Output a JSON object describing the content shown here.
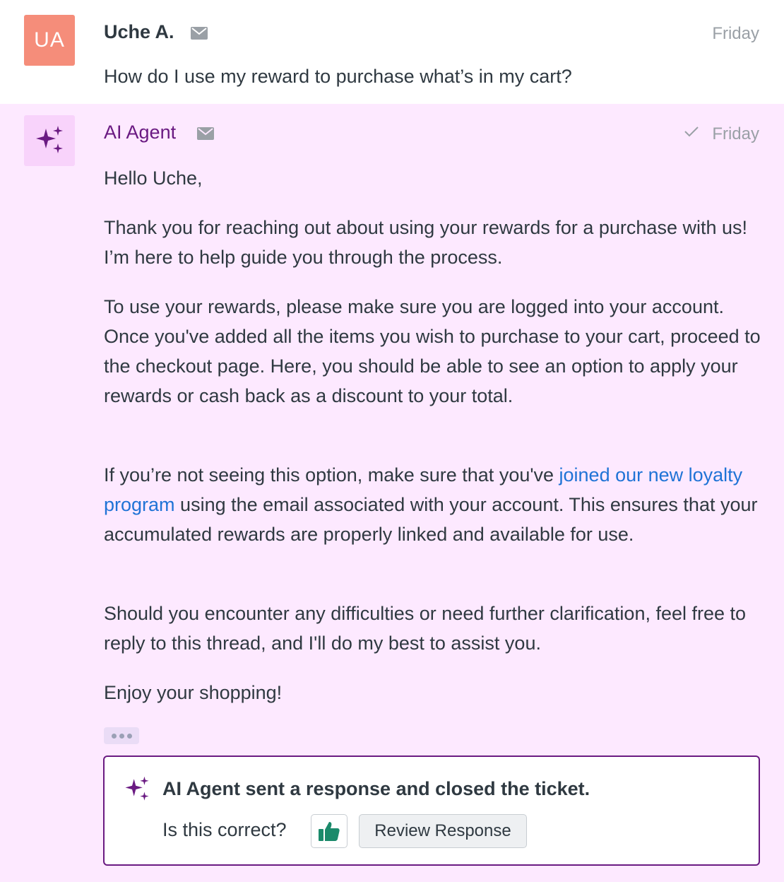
{
  "user_message": {
    "avatar_initials": "UA",
    "author": "Uche A.",
    "channel_icon": "mail-icon",
    "time": "Friday",
    "text": "How do I use my reward to purchase what’s in my cart?"
  },
  "agent_message": {
    "avatar_icon": "sparkles-icon",
    "author": "AI Agent",
    "channel_icon": "mail-icon",
    "status_icon": "checkmark-icon",
    "time": "Friday",
    "greeting": "Hello Uche,",
    "p1": "Thank you for reaching out about using your rewards for a purchase with us! I’m here to help guide you through the process.",
    "p2": "To use your rewards, please make sure you are logged into your account. Once you've added all the items you wish to purchase to your cart, proceed to the checkout page. Here, you should be able to see an option to apply your rewards or cash back as a discount to your total.",
    "p3_before": "If you’re not seeing this option, make sure that you've ",
    "p3_link": "joined our new loyalty program",
    "p3_after": " using the email associated with your account. This ensures that your accumulated rewards are properly linked and available for use.",
    "p4": "Should you encounter any difficulties or need further clarification, feel free to reply to this thread, and I'll do my best to assist you.",
    "p5": "Enjoy your shopping!"
  },
  "notice": {
    "icon": "sparkles-icon",
    "title": "AI Agent sent a response and closed the ticket.",
    "question": "Is this correct?",
    "thumbs_icon": "thumbs-up-icon",
    "review_label": "Review Response"
  },
  "colors": {
    "agent_bg": "#fde9ff",
    "agent_accent": "#6a1a82",
    "user_avatar": "#f58d7a",
    "link": "#1f73d6",
    "thumb": "#1b8a6b"
  }
}
